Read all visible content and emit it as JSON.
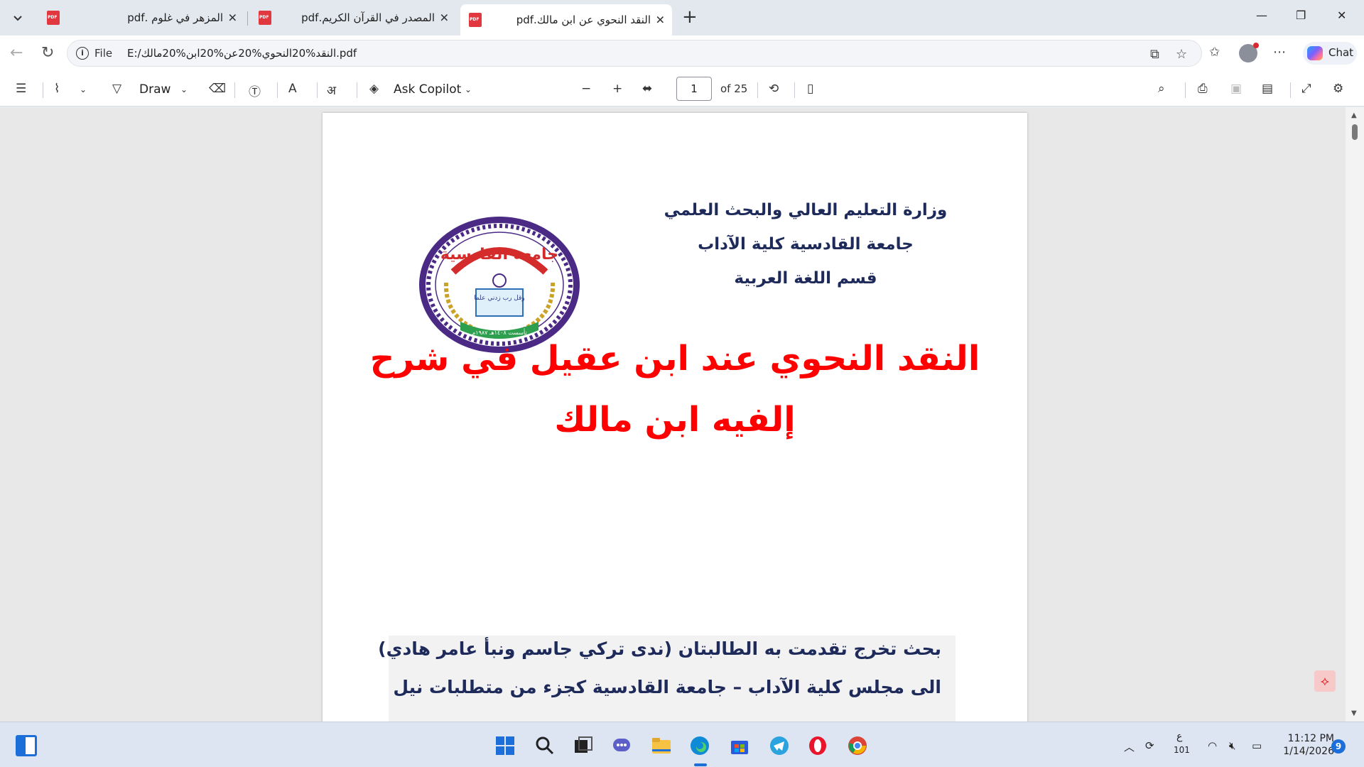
{
  "browser": {
    "tabs": [
      {
        "title": "المزهر في غلوم .pdf",
        "active": false
      },
      {
        "title": "المصدر في القرآن الكريم.pdf",
        "active": false
      },
      {
        "title": "النقد النحوي عن ابن مالك.pdf",
        "active": true
      }
    ],
    "new_tab_icon": "plus-icon",
    "address": {
      "scheme_label": "File",
      "url": "E:/النقد%20النحوي%20عن%20ابن%20مالك.pdf"
    },
    "chat_label": "Chat"
  },
  "pdf_toolbar": {
    "draw_label": "Draw",
    "copilot_label": "Ask Copilot",
    "page_number": "1",
    "page_count": "of 25"
  },
  "document": {
    "institution": [
      "وزارة التعليم العالي والبحث العلمي",
      "جامعة القادسية كلية الآداب",
      "قسم اللغة العربية"
    ],
    "logo": {
      "name_text": "جامعة القادسية",
      "motto": "وقل رب زدني علما",
      "year": "تأسست ١٤٠٨هـ ١٩٨٧م"
    },
    "title_lines": [
      "النقد النحوي عند ابن عقيل في شرح",
      "إلفيه ابن مالك"
    ],
    "abstract_lines": [
      "بحث تخرج تقدمت به الطالبتان (ندى تركي جاسم ونبأ عامر هادي)",
      "الى مجلس كلية الآداب – جامعة القادسية كجزء من متطلبات نيل"
    ]
  },
  "colors": {
    "title_red": "#ff0000",
    "institution_navy": "#1e2b5a",
    "logo_purple": "#4b2a86",
    "logo_green": "#2e9e4f",
    "logo_red": "#d42b2b"
  },
  "taskbar": {
    "keyboard_lang": "ع",
    "keyboard_sub": "101",
    "time": "11:12 PM",
    "date": "1/14/2026",
    "notification_count": "9"
  }
}
